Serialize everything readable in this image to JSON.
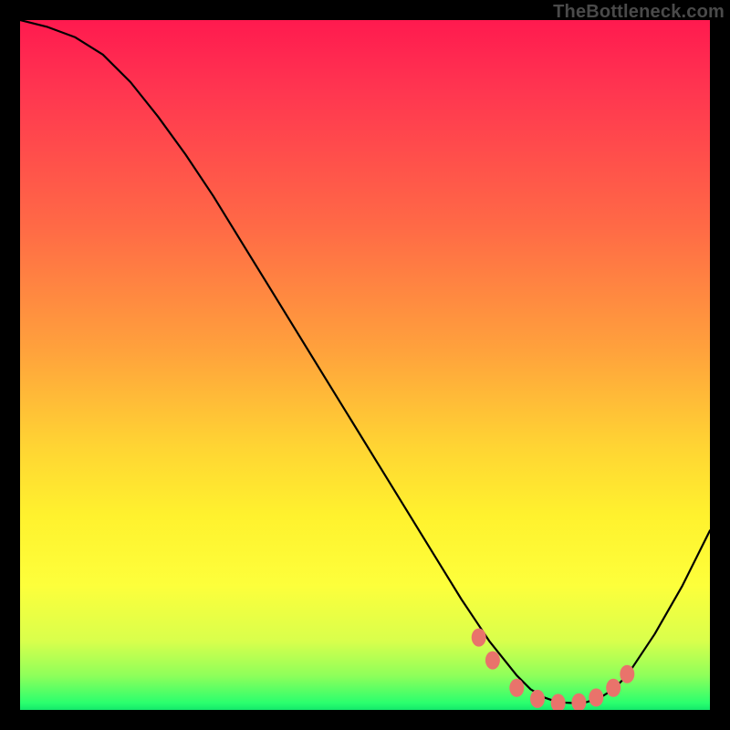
{
  "watermark": "TheBottleneck.com",
  "chart_data": {
    "type": "line",
    "title": "",
    "xlabel": "",
    "ylabel": "",
    "xlim": [
      0,
      100
    ],
    "ylim": [
      0,
      100
    ],
    "grid": false,
    "legend": false,
    "series": [
      {
        "name": "curve",
        "x": [
          0,
          4,
          8,
          12,
          16,
          20,
          24,
          28,
          32,
          36,
          40,
          44,
          48,
          52,
          56,
          60,
          64,
          66,
          68,
          70,
          72,
          74,
          76,
          78,
          80,
          82,
          84,
          86,
          88,
          92,
          96,
          100
        ],
        "y": [
          100,
          99,
          97.5,
          95,
          91,
          86,
          80.5,
          74.5,
          68,
          61.5,
          55,
          48.5,
          42,
          35.5,
          29,
          22.5,
          16,
          13,
          10,
          7.5,
          5,
          3,
          1.8,
          1.1,
          1,
          1.1,
          1.7,
          3,
          5,
          11,
          18,
          26
        ]
      }
    ],
    "markers": {
      "name": "highlight",
      "color": "#e9736b",
      "x": [
        66.5,
        68.5,
        72,
        75,
        78,
        81,
        83.5,
        86,
        88
      ],
      "y": [
        10.5,
        7.2,
        3.2,
        1.6,
        1.0,
        1.1,
        1.8,
        3.2,
        5.2
      ]
    }
  }
}
